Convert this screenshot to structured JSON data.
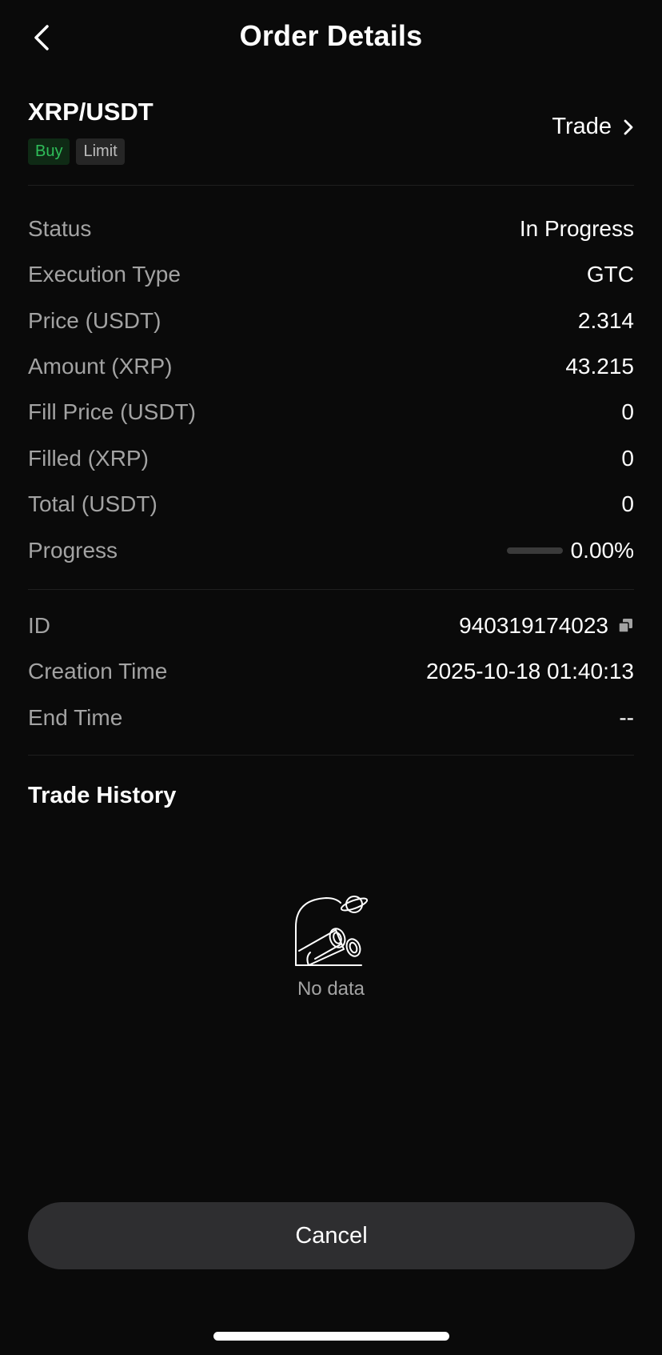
{
  "header": {
    "title": "Order Details",
    "back_icon": "chevron-left-icon"
  },
  "pair": {
    "name": "XRP/USDT",
    "side_tag": "Buy",
    "type_tag": "Limit",
    "trade_link": "Trade",
    "trade_icon": "chevron-right-icon",
    "colors": {
      "buy": "#2fbf5a",
      "buy_bg": "#0f2a15",
      "limit_bg": "#262626"
    }
  },
  "details": {
    "status": {
      "label": "Status",
      "value": "In Progress"
    },
    "execution_type": {
      "label": "Execution Type",
      "value": "GTC"
    },
    "price": {
      "label": "Price (USDT)",
      "value": "2.314"
    },
    "amount": {
      "label": "Amount (XRP)",
      "value": "43.215"
    },
    "fill_price": {
      "label": "Fill Price (USDT)",
      "value": "0"
    },
    "filled": {
      "label": "Filled (XRP)",
      "value": "0"
    },
    "total": {
      "label": "Total (USDT)",
      "value": "0"
    },
    "progress": {
      "label": "Progress",
      "value": "0.00%",
      "fraction": 0
    }
  },
  "meta": {
    "id": {
      "label": "ID",
      "value": "940319174023",
      "icon": "copy-icon"
    },
    "creation_time": {
      "label": "Creation Time",
      "value": "2025-10-18 01:40:13"
    },
    "end_time": {
      "label": "End Time",
      "value": "--"
    }
  },
  "trade_history": {
    "title": "Trade History",
    "empty_text": "No data",
    "empty_icon": "binoculars-planet-icon"
  },
  "actions": {
    "cancel_label": "Cancel"
  }
}
